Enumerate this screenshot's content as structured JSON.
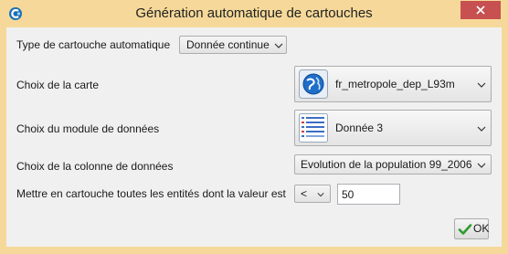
{
  "window": {
    "title": "Génération automatique de cartouches",
    "icon": "app-logo-icon",
    "close_icon": "close-icon",
    "close_color": "#c75050"
  },
  "form": {
    "type_label": "Type de cartouche automatique",
    "type_value": "Donnée continue",
    "map_label": "Choix de la carte",
    "map_value": "fr_metropole_dep_L93m",
    "map_icon": "globe-icon",
    "module_label": "Choix du module de données",
    "module_value": "Donnée 3",
    "module_icon": "data-table-icon",
    "column_label": "Choix de la colonne de données",
    "column_value": "Evolution de la population 99_2006",
    "condition_label": "Mettre en cartouche toutes les entités dont la valeur est",
    "operator_value": "<",
    "threshold_value": "50"
  },
  "actions": {
    "ok_label": "OK",
    "ok_icon": "checkmark-icon"
  },
  "colors": {
    "frame": "#f6d99a",
    "client": "#f0f0f0"
  }
}
